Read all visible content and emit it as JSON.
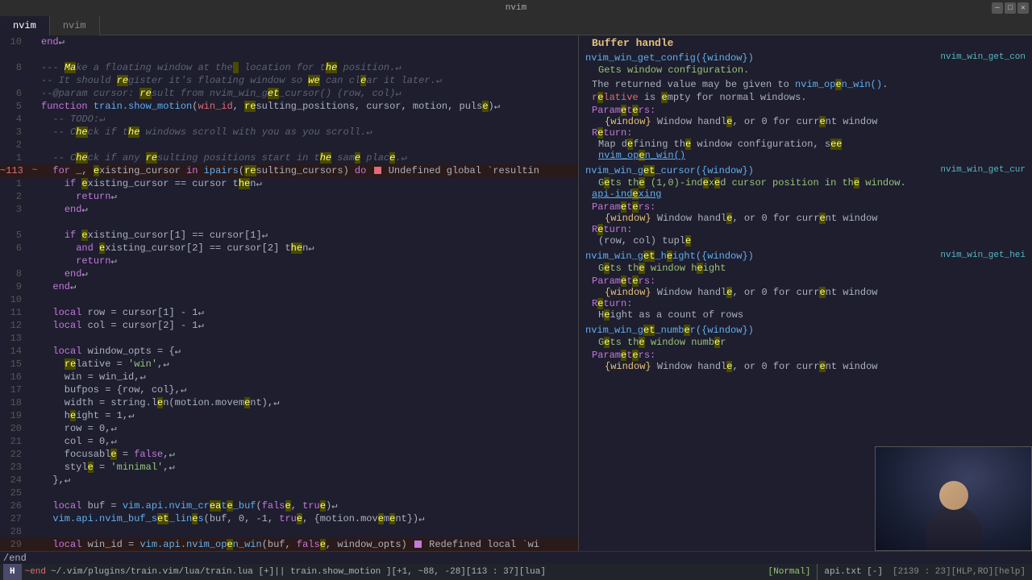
{
  "titlebar": {
    "title": "nvim",
    "minimize": "─",
    "maximize": "□",
    "close": "✕"
  },
  "tabs": [
    {
      "label": "nvim",
      "active": true
    },
    {
      "label": "nvim",
      "active": false
    }
  ],
  "left_pane": {
    "lines": [
      {
        "num": "10",
        "gutter": "",
        "content": "end↵"
      },
      {
        "num": "",
        "gutter": "",
        "content": ""
      },
      {
        "num": "8",
        "gutter": "",
        "content": "--- Make a floating window at the location for the position.↵"
      },
      {
        "num": "",
        "gutter": "",
        "content": "-- It should register it's floating window so we can clear it later.↵"
      },
      {
        "num": "6",
        "gutter": "",
        "content": "--@param cursor: result from nvim_win_get_cursor() (row, col)↵"
      },
      {
        "num": "5",
        "gutter": "",
        "content": "function train.show_motion(win_id, resulting_positions, cursor, motion, pulse)↵"
      },
      {
        "num": "4",
        "gutter": "",
        "content": "  -- TODO:↵"
      },
      {
        "num": "3",
        "gutter": "",
        "content": "  -- Check if the windows scroll with you as you scroll.↵"
      },
      {
        "num": "2",
        "gutter": "",
        "content": ""
      },
      {
        "num": "1",
        "gutter": "",
        "content": "  -- Check if any resulting positions start in the same place.↵"
      },
      {
        "num": "~113",
        "gutter": "~",
        "content": "  for _, existing_cursor in ipairs(resulting_cursors) do ■ Undefined global `resultin"
      },
      {
        "num": "1",
        "gutter": "",
        "content": "    if existing_cursor == cursor then↵"
      },
      {
        "num": "2",
        "gutter": "",
        "content": "      return↵"
      },
      {
        "num": "3",
        "gutter": "",
        "content": "    end↵"
      },
      {
        "num": "",
        "gutter": "",
        "content": ""
      },
      {
        "num": "5",
        "gutter": "",
        "content": "    if existing_cursor[1] == cursor[1]↵"
      },
      {
        "num": "6",
        "gutter": "",
        "content": "      and existing_cursor[2] == cursor[2] then↵"
      },
      {
        "num": "",
        "gutter": "",
        "content": "      return↵"
      },
      {
        "num": "8",
        "gutter": "",
        "content": "    end↵"
      },
      {
        "num": "9",
        "gutter": "",
        "content": "  end↵"
      },
      {
        "num": "10",
        "gutter": "",
        "content": ""
      },
      {
        "num": "11",
        "gutter": "",
        "content": "  local row = cursor[1] - 1↵"
      },
      {
        "num": "12",
        "gutter": "",
        "content": "  local col = cursor[2] - 1↵"
      },
      {
        "num": "13",
        "gutter": "",
        "content": ""
      },
      {
        "num": "14",
        "gutter": "",
        "content": "  local window_opts = {↵"
      },
      {
        "num": "15",
        "gutter": "",
        "content": "    relative = 'win',↵"
      },
      {
        "num": "16",
        "gutter": "",
        "content": "    win = win_id,↵"
      },
      {
        "num": "17",
        "gutter": "",
        "content": "    bufpos = {row, col},↵"
      },
      {
        "num": "18",
        "gutter": "",
        "content": "    width = string.len(motion.movement),↵"
      },
      {
        "num": "19",
        "gutter": "",
        "content": "    height = 1,↵"
      },
      {
        "num": "20",
        "gutter": "",
        "content": "    row = 0,↵"
      },
      {
        "num": "21",
        "gutter": "",
        "content": "    col = 0,↵"
      },
      {
        "num": "22",
        "gutter": "",
        "content": "    focusable = false,↵"
      },
      {
        "num": "23",
        "gutter": "",
        "content": "    style = 'minimal',↵"
      },
      {
        "num": "24",
        "gutter": "",
        "content": "  },↵"
      },
      {
        "num": "25",
        "gutter": "",
        "content": ""
      },
      {
        "num": "26",
        "gutter": "",
        "content": "  local buf = vim.api.nvim_create_buf(false, true)↵"
      },
      {
        "num": "27",
        "gutter": "",
        "content": "  vim.api.nvim_buf_set_lines(buf, 0, -1, true, {motion.movement})↵"
      },
      {
        "num": "28",
        "gutter": "",
        "content": ""
      },
      {
        "num": "29",
        "gutter": "",
        "content": "  local win_id = vim.api.nvim_open_win(buf, false, window_opts) ■ Redefined local `wi"
      }
    ]
  },
  "right_pane": {
    "sections": [
      {
        "fn_name": "nvim_win_get_config({window})",
        "fn_right": "nvim_win_get_con",
        "desc": "Gets window configuration.",
        "extra": "The returned value may be given to nvim_open_win().",
        "relative_note": "relative is empty for normal windows.",
        "params_label": "Parameters:",
        "params": [
          {
            "name": "{window}",
            "desc": "Window handle, or 0 for current window"
          }
        ],
        "return_label": "Return:",
        "return_desc": "Map defining the window configuration, see",
        "return_link": "nvim_open_win()"
      },
      {
        "fn_name": "nvim_win_get_cursor({window})",
        "fn_right": "nvim_win_get_cur",
        "desc": "Gets the (1,0)-indexed cursor position in the window.",
        "extra": "api-indexing",
        "params_label": "Parameters:",
        "params": [
          {
            "name": "{window}",
            "desc": "Window handle, or 0 for current window"
          }
        ],
        "return_label": "Return:",
        "return_desc": "(row, col) tuple"
      },
      {
        "fn_name": "nvim_win_get_height({window})",
        "fn_right": "nvim_win_get_hei",
        "desc": "Gets the window height",
        "params_label": "Parameters:",
        "params": [
          {
            "name": "{window}",
            "desc": "Window handle, or 0 for current window"
          }
        ],
        "return_label": "Return:",
        "return_desc": "Height as a count of rows"
      },
      {
        "fn_name": "nvim_win_get_number({window})",
        "fn_right": "",
        "desc": "Gets the window number",
        "params_label": "Parameters:",
        "params": [
          {
            "name": "{window}",
            "desc": "Window handle, or 0 for current window"
          }
        ]
      }
    ]
  },
  "status_bar": {
    "mode": "H",
    "end_marker": "~end",
    "file_path": "~/.vim/plugins/train.vim/lua/train.lua [+]|| train.show_motion ][+1, ~88, -28][113 : 37][lua]",
    "right_mode": "[Normal]",
    "right_file": "api.txt [-]",
    "right_pos": "[2139 : 23][HLP,RO][help]"
  },
  "command_line": {
    "text": "/end"
  },
  "webcam": {
    "visible": true
  }
}
